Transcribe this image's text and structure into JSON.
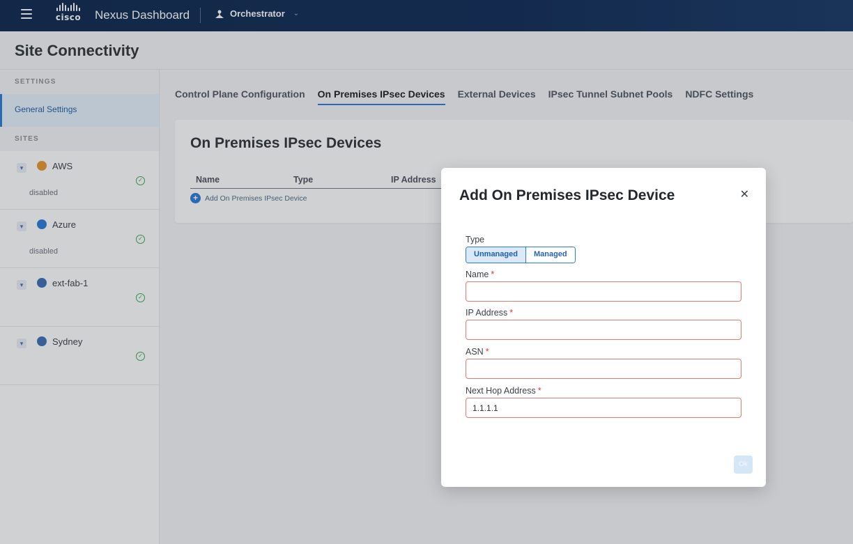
{
  "header": {
    "app_title": "Nexus Dashboard",
    "logo_text": "cisco",
    "context_label": "Orchestrator"
  },
  "page": {
    "title": "Site Connectivity"
  },
  "sidebar": {
    "settings_heading": "SETTINGS",
    "general_settings": "General Settings",
    "sites_heading": "SITES",
    "sites": [
      {
        "name": "AWS",
        "status": "disabled",
        "icon_color": "#e8962e"
      },
      {
        "name": "Azure",
        "status": "disabled",
        "icon_color": "#2b7ad6"
      },
      {
        "name": "ext-fab-1",
        "status": "",
        "icon_color": "#3a6fb3"
      },
      {
        "name": "Sydney",
        "status": "",
        "icon_color": "#3a6fb3"
      }
    ]
  },
  "tabs": [
    {
      "label": "Control Plane Configuration",
      "active": false
    },
    {
      "label": "On Premises IPsec Devices",
      "active": true
    },
    {
      "label": "External Devices",
      "active": false
    },
    {
      "label": "IPsec Tunnel Subnet Pools",
      "active": false
    },
    {
      "label": "NDFC Settings",
      "active": false
    }
  ],
  "card": {
    "title": "On Premises IPsec Devices",
    "columns": [
      "Name",
      "Type",
      "IP Address"
    ],
    "add_label": "Add On Premises IPsec Device"
  },
  "modal": {
    "title": "Add On Premises IPsec Device",
    "type_label": "Type",
    "type_options": [
      "Unmanaged",
      "Managed"
    ],
    "type_selected": "Unmanaged",
    "fields": [
      {
        "label": "Name",
        "value": ""
      },
      {
        "label": "IP Address",
        "value": ""
      },
      {
        "label": "ASN",
        "value": ""
      },
      {
        "label": "Next Hop Address",
        "value": "1.1.1.1"
      }
    ],
    "ok_label": "Ok"
  },
  "colors": {
    "accent": "#2b7ad6",
    "topbar": "#0d274d",
    "required": "#d23b3b",
    "field_error_border": "#e07a6f",
    "success": "#3aa657"
  }
}
